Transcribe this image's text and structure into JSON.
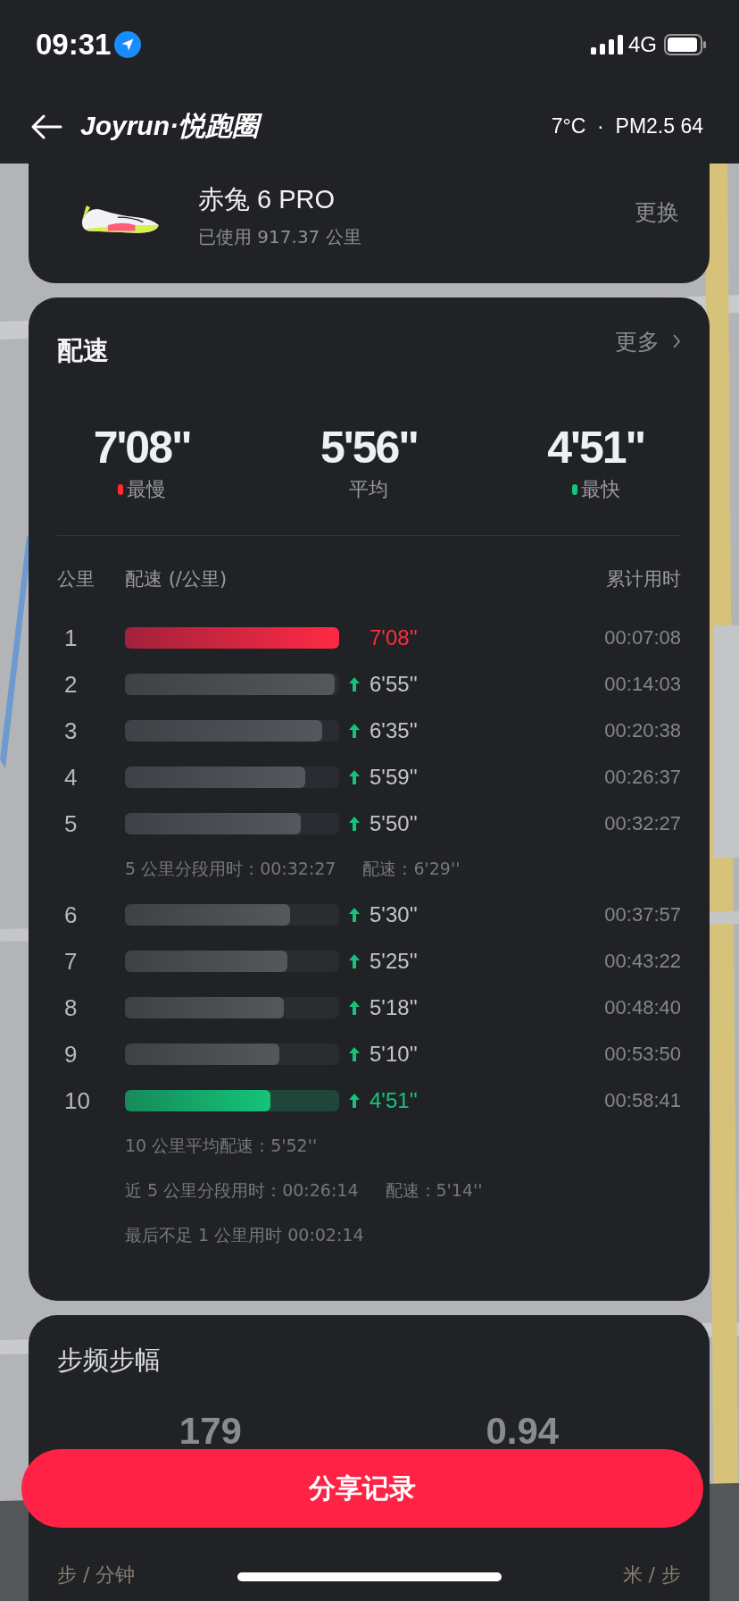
{
  "status_bar": {
    "time": "09:31",
    "network": "4G"
  },
  "nav": {
    "title": "Joyrun·悦跑圈",
    "weather": "7°C  ·  PM2.5 64"
  },
  "shoe": {
    "name": "赤兔 6 PRO",
    "usage": "已使用 917.37 公里",
    "action": "更换"
  },
  "pace": {
    "title": "配速",
    "more": "更多",
    "stats": [
      {
        "value": "7'08\"",
        "label": "最慢",
        "color": "#ff2a35"
      },
      {
        "value": "5'56\"",
        "label": "平均"
      },
      {
        "value": "4'51\"",
        "label": "最快",
        "color": "#14c47a"
      }
    ],
    "columns": [
      "公里",
      "配速 (/公里)",
      "累计用时"
    ],
    "rows": [
      {
        "kind": "slowest",
        "km": "1",
        "level": 1.0,
        "pace": "7'08''",
        "time": "00:07:08"
      },
      {
        "kind": "split",
        "km": "2",
        "level": 0.98,
        "pace": "6'55''",
        "time": "00:14:03"
      },
      {
        "kind": "split",
        "km": "3",
        "level": 0.92,
        "pace": "6'35''",
        "time": "00:20:38"
      },
      {
        "kind": "split",
        "km": "4",
        "level": 0.84,
        "pace": "5'59''",
        "time": "00:26:37"
      },
      {
        "kind": "split",
        "km": "5",
        "level": 0.82,
        "pace": "5'50''",
        "time": "00:32:27"
      },
      {
        "kind": "note",
        "parts": [
          "5 公里分段用时：00:32:27",
          "配速：6'29''"
        ]
      },
      {
        "kind": "split",
        "km": "6",
        "level": 0.77,
        "pace": "5'30''",
        "time": "00:37:57"
      },
      {
        "kind": "split",
        "km": "7",
        "level": 0.76,
        "pace": "5'25''",
        "time": "00:43:22"
      },
      {
        "kind": "split",
        "km": "8",
        "level": 0.74,
        "pace": "5'18''",
        "time": "00:48:40"
      },
      {
        "kind": "split",
        "km": "9",
        "level": 0.72,
        "pace": "5'10''",
        "time": "00:53:50"
      },
      {
        "kind": "fastest",
        "km": "10",
        "level": 0.68,
        "pace": "4'51''",
        "time": "00:58:41"
      },
      {
        "kind": "note",
        "parts": [
          "10 公里平均配速：5'52''"
        ]
      },
      {
        "kind": "note",
        "parts": [
          "近 5 公里分段用时：00:26:14",
          "配速：5'14''"
        ]
      },
      {
        "kind": "note",
        "parts": [
          "最后不足 1 公里用时 00:02:14"
        ]
      }
    ]
  },
  "cadence": {
    "title": "步频步幅",
    "values": [
      {
        "value": "179",
        "unit": "步 / 分钟"
      },
      {
        "value": "0.94",
        "unit": "米 / 步"
      }
    ]
  },
  "share_button": "分享记录"
}
